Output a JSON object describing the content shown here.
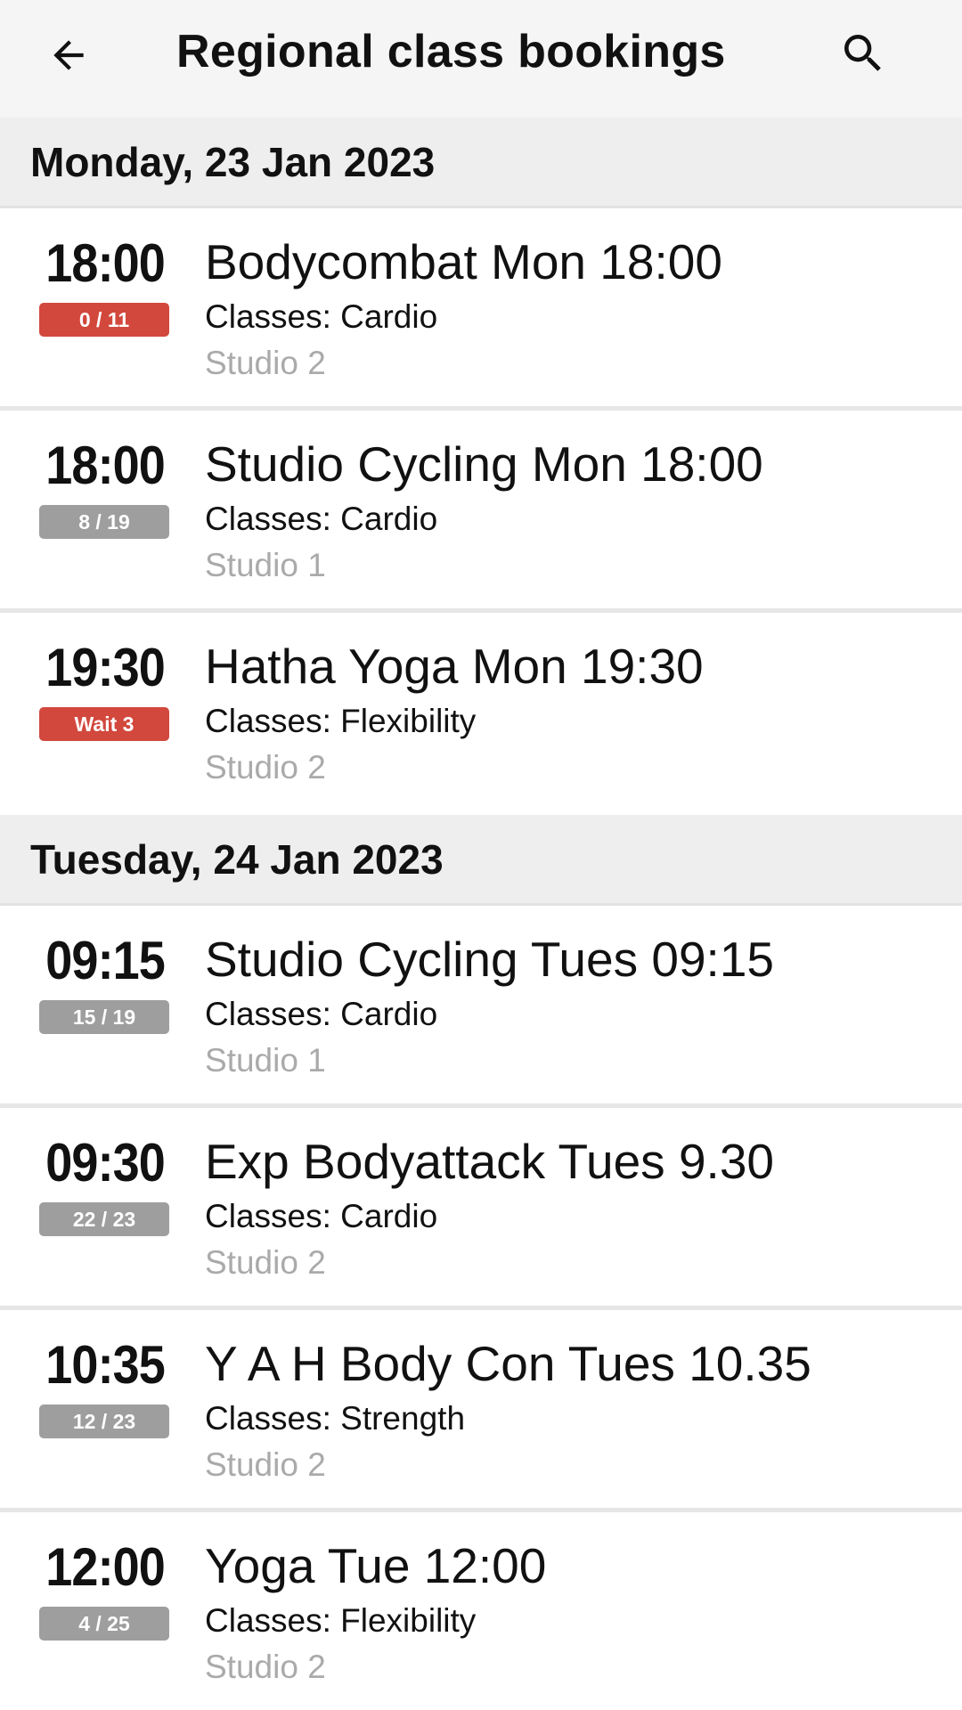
{
  "app_bar": {
    "title": "Regional class bookings",
    "back_icon": "arrow-left-icon",
    "search_icon": "search-icon"
  },
  "colors": {
    "badge_red": "#d2483d",
    "badge_grey": "#9e9e9e",
    "day_header_bg": "#eeeeee",
    "room_text": "#aaaaaa"
  },
  "days": [
    {
      "header": "Monday, 23 Jan 2023",
      "classes": [
        {
          "time": "18:00",
          "badge": "0 / 11",
          "badge_color": "red",
          "name": "Bodycombat Mon 18:00",
          "type": "Classes: Cardio",
          "room": "Studio 2"
        },
        {
          "time": "18:00",
          "badge": "8 / 19",
          "badge_color": "grey",
          "name": "Studio Cycling Mon 18:00",
          "type": "Classes: Cardio",
          "room": "Studio 1"
        },
        {
          "time": "19:30",
          "badge": "Wait 3",
          "badge_color": "red",
          "name": "Hatha Yoga Mon 19:30",
          "type": "Classes: Flexibility",
          "room": "Studio 2"
        }
      ]
    },
    {
      "header": "Tuesday, 24 Jan 2023",
      "classes": [
        {
          "time": "09:15",
          "badge": "15 / 19",
          "badge_color": "grey",
          "name": "Studio Cycling Tues 09:15",
          "type": "Classes: Cardio",
          "room": "Studio 1"
        },
        {
          "time": "09:30",
          "badge": "22 / 23",
          "badge_color": "grey",
          "name": "Exp Bodyattack Tues 9.30",
          "type": "Classes: Cardio",
          "room": "Studio 2"
        },
        {
          "time": "10:35",
          "badge": "12 / 23",
          "badge_color": "grey",
          "name": "Y A H Body Con Tues 10.35",
          "type": "Classes: Strength",
          "room": "Studio 2"
        },
        {
          "time": "12:00",
          "badge": "4 / 25",
          "badge_color": "grey",
          "name": "Yoga Tue 12:00",
          "type": "Classes: Flexibility",
          "room": "Studio 2"
        }
      ]
    }
  ]
}
